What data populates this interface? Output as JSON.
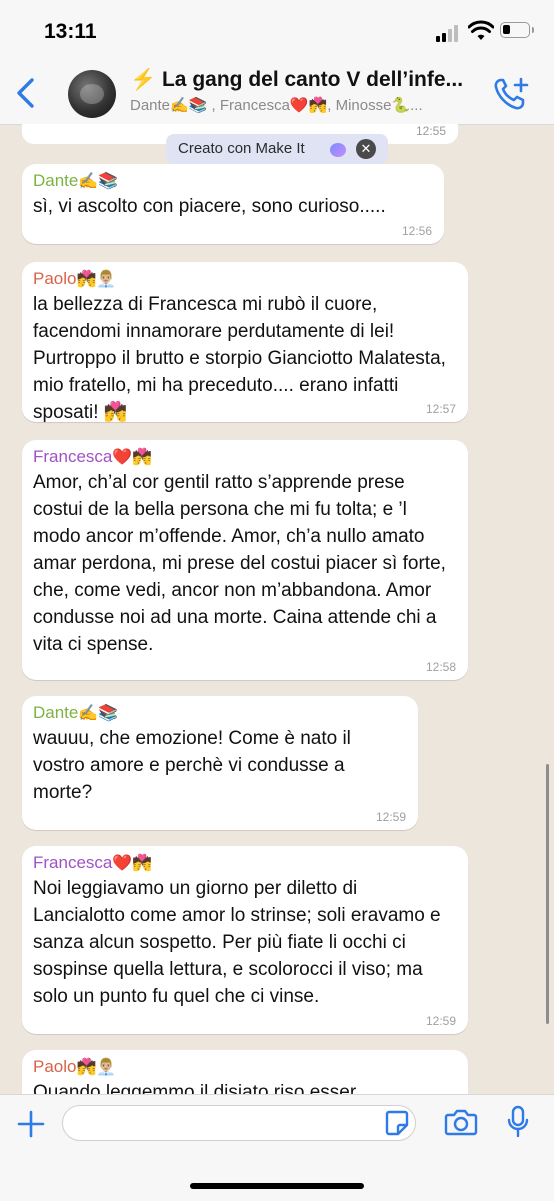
{
  "status": {
    "time": "13:11"
  },
  "header": {
    "title": "⚡ La gang del canto V dell’infe...",
    "subtitle": "Dante✍️📚 , Francesca❤️💏, Minosse🐍..."
  },
  "chat": {
    "top_partial_time": "12:55",
    "banner": {
      "label": "Creato con Make It"
    },
    "messages": [
      {
        "sender": "Dante",
        "sender_emoji": "✍️📚",
        "sender_color": "#7cb342",
        "text": "sì, vi ascolto con piacere, sono curioso.....",
        "time": "12:56"
      },
      {
        "sender": "Paolo",
        "sender_emoji": "💏👨🏼‍💼",
        "sender_color": "#d9634a",
        "text": "la bellezza di Francesca mi rubò il cuore, facendomi innamorare perdutamente di lei! Purtroppo il brutto e storpio Gianciotto Malatesta, mio fratello, mi ha preceduto.... erano infatti sposati! 💏",
        "time": "12:57"
      },
      {
        "sender": "Francesca",
        "sender_emoji": "❤️💏",
        "sender_color": "#a052c4",
        "text": "Amor, ch’al cor gentil ratto s’apprende prese costui de la bella persona che mi fu tolta; e ’l modo ancor m’offende. Amor, ch’a nullo amato amar perdona, mi prese del costui piacer sì forte, che, come vedi, ancor non m’abbandona. Amor condusse noi ad una morte. Caina attende chi a vita ci spense.",
        "time": "12:58"
      },
      {
        "sender": "Dante",
        "sender_emoji": "✍️📚",
        "sender_color": "#7cb342",
        "text": "wauuu, che emozione! Come è nato il vostro amore e perchè vi condusse a morte?",
        "time": "12:59"
      },
      {
        "sender": "Francesca",
        "sender_emoji": "❤️💏",
        "sender_color": "#a052c4",
        "text": "Noi leggiavamo un giorno per diletto di Lancialotto come amor lo strinse; soli eravamo e sanza alcun sospetto. Per più fiate li occhi ci sospinse quella lettura, e scolorocci il viso; ma solo un punto fu quel che ci vinse.",
        "time": "12:59"
      },
      {
        "sender": "Paolo",
        "sender_emoji": "💏👨🏼‍💼",
        "sender_color": "#d9634a",
        "text": "Quando leggemmo il disiato riso esser",
        "time": ""
      }
    ]
  },
  "composer": {
    "placeholder": ""
  }
}
